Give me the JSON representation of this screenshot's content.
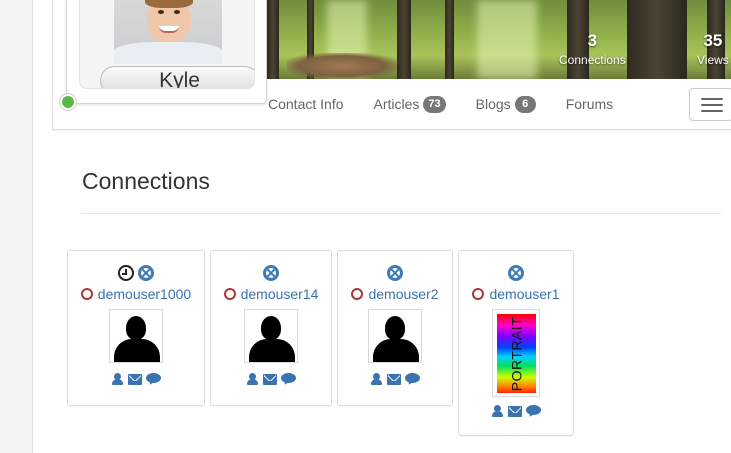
{
  "profile": {
    "name": "Kyle",
    "status": "online",
    "stats": [
      {
        "value": "3",
        "label": "Connections"
      },
      {
        "value": "35",
        "label": "Views"
      }
    ]
  },
  "tabs": [
    {
      "label": "Contact Info",
      "badge": null
    },
    {
      "label": "Articles",
      "badge": "73"
    },
    {
      "label": "Blogs",
      "badge": "6"
    },
    {
      "label": "Forums",
      "badge": null
    }
  ],
  "section": {
    "title": "Connections"
  },
  "connections": [
    {
      "name": "demouser1000",
      "pending": true,
      "avatar": "silhouette"
    },
    {
      "name": "demouser14",
      "pending": false,
      "avatar": "silhouette"
    },
    {
      "name": "demouser2",
      "pending": false,
      "avatar": "silhouette"
    },
    {
      "name": "demouser1",
      "pending": false,
      "avatar": "portrait",
      "portrait_text": "PORTRAIT"
    }
  ],
  "icons": {
    "menu": "hamburger-icon",
    "status": "status-ring-icon",
    "remove": "remove-circle-icon",
    "pending": "clock-icon",
    "profile": "user-icon",
    "message": "envelope-icon",
    "chat": "chat-bubble-icon"
  },
  "colors": {
    "link": "#3b73af",
    "online": "#59b84a",
    "offline_ring": "#a33a3a",
    "badge": "#777777"
  }
}
